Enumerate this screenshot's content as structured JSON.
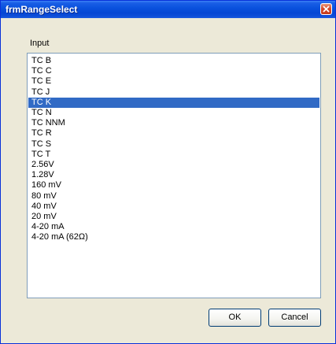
{
  "window": {
    "title": "frmRangeSelect"
  },
  "group": {
    "label": "Input"
  },
  "list": {
    "items": [
      "TC B",
      "TC C",
      "TC E",
      "TC J",
      "TC K",
      "TC N",
      "TC NNM",
      "TC R",
      "TC S",
      "TC T",
      "2.56V",
      "1.28V",
      "160 mV",
      "80 mV",
      "40 mV",
      "20 mV",
      "4-20 mA",
      "4-20 mA (62Ω)"
    ],
    "selected_index": 4
  },
  "buttons": {
    "ok_label": "OK",
    "cancel_label": "Cancel"
  },
  "colors": {
    "title_bar": "#0a52de",
    "selection": "#316ac5",
    "dialog_bg": "#ece9d8",
    "close_button": "#d8492a"
  },
  "icons": {
    "close": "close-icon"
  }
}
